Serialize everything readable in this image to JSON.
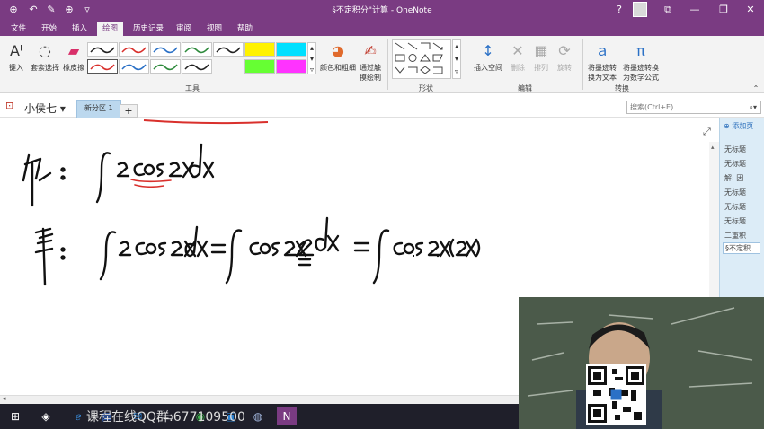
{
  "app": {
    "title": "§不定积分\"计算 - OneNote",
    "window_buttons": [
      "?",
      "⧉",
      "—",
      "❐",
      "✕"
    ]
  },
  "quick_access": [
    "⊕",
    "↶",
    "✎",
    "⊕",
    "▿"
  ],
  "ribbon_tabs": [
    "文件",
    "开始",
    "插入",
    "绘图",
    "历史记录",
    "审阅",
    "视图",
    "帮助"
  ],
  "ribbon": {
    "tools": {
      "type_label": "键入",
      "lasso_label": "套索选择",
      "eraser_label": "橡皮擦",
      "color_thickness_label": "颜色和粗细",
      "touch_draw_label": "通过触摸绘制",
      "group_label": "工具"
    },
    "shapes_group_label": "形状",
    "edit": {
      "insert_space_label": "插入空间",
      "delete_label": "删除",
      "arrange_label": "排列",
      "rotate_label": "旋转",
      "group_label": "编辑"
    },
    "convert": {
      "ink_to_text_label": "将墨迹转换为文本",
      "ink_to_math_label": "将墨迹转换为数学公式",
      "group_label": "转换"
    },
    "pen_colors": [
      "#222222",
      "#d9302c",
      "#2a70c6",
      "#2e8a3c",
      "#222222",
      "#d9302c",
      "#2a70c6",
      "#2e8a3c"
    ],
    "highlighter_colors": [
      "#fff200",
      "#00e0ff",
      "#66ff33",
      "#ff33ff"
    ]
  },
  "notebook": {
    "name": "小侯七",
    "section_tab": "新分区 1",
    "add_section": "+"
  },
  "search": {
    "placeholder": "搜索(Ctrl+E)",
    "icon": "search-icon"
  },
  "pages": {
    "add_page": "添加页",
    "items": [
      "无标题",
      "无标题",
      "解: 因",
      "无标题",
      "无标题",
      "无标题",
      "二重积",
      "§不定积"
    ]
  },
  "taskbar": {
    "watermark": "课程在线QQ群:677109500"
  }
}
